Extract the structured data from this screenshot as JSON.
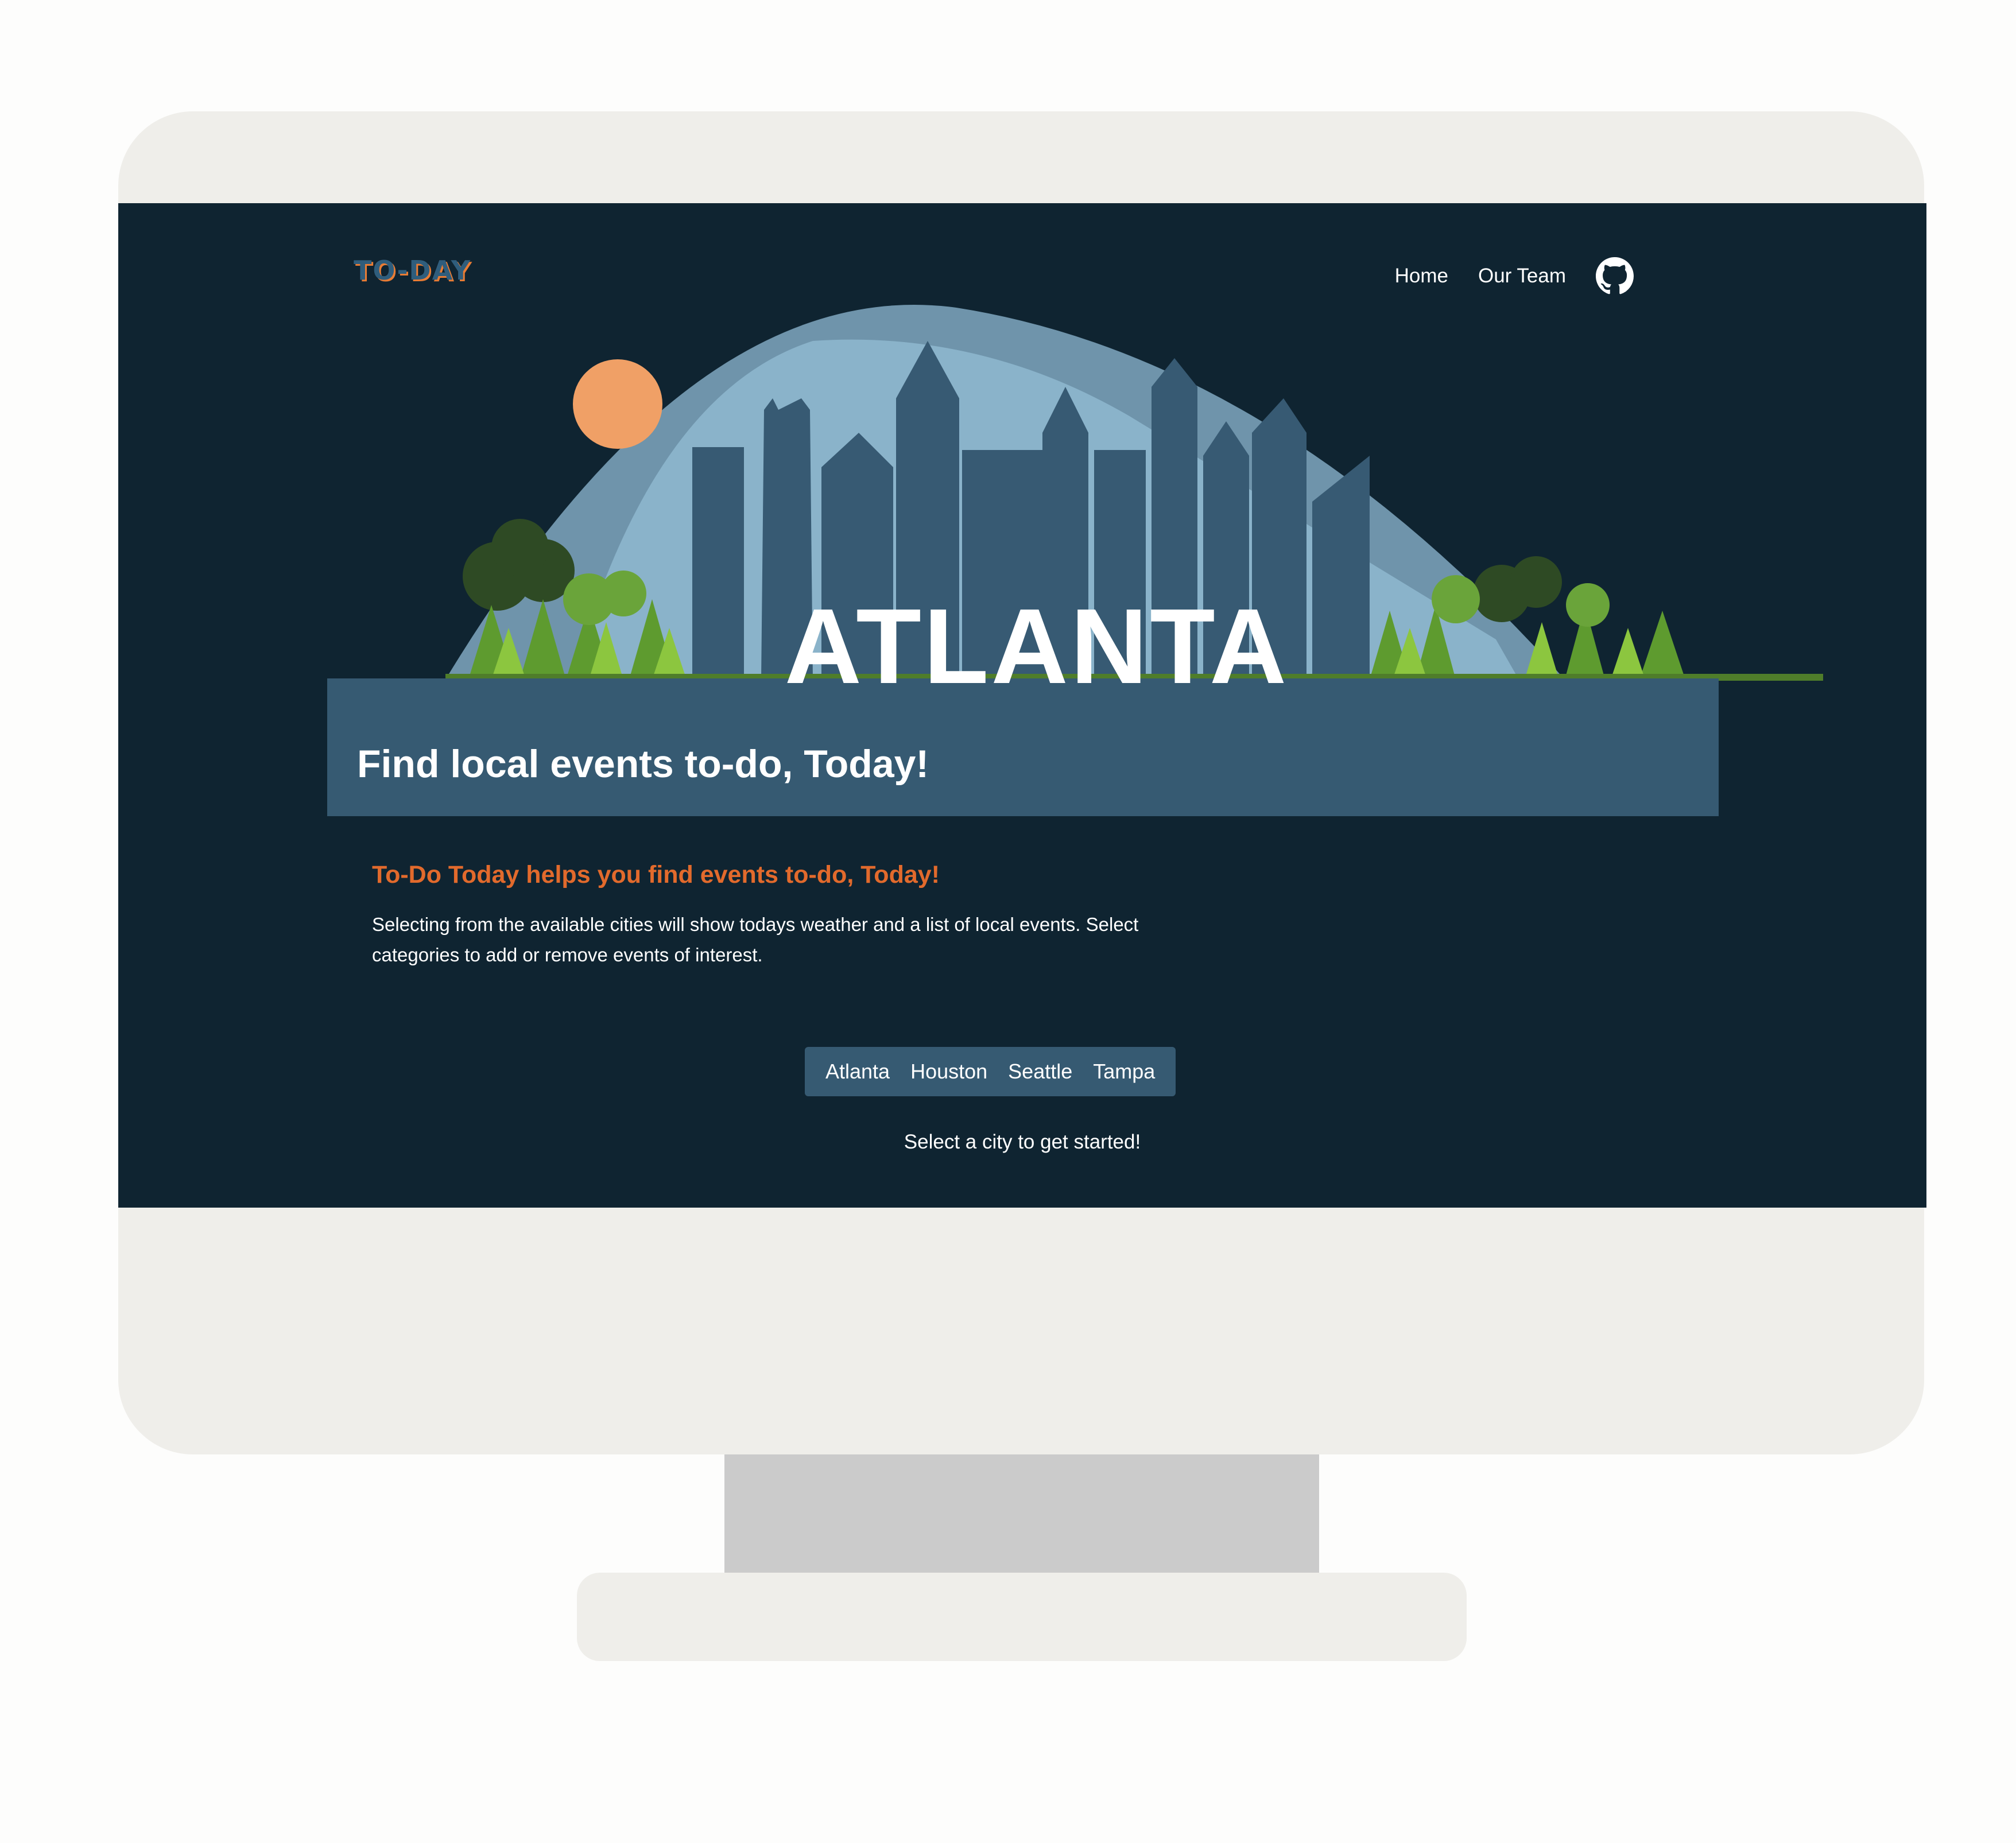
{
  "header": {
    "logo_text": "TO-DAY",
    "nav": [
      {
        "label": "Home"
      },
      {
        "label": "Our Team"
      }
    ],
    "github_icon": "github-icon"
  },
  "hero": {
    "city_name": "ATLANTA",
    "tagline": "Find local events to-do, Today!"
  },
  "intro": {
    "heading": "To-Do Today helps you find events to-do, Today!",
    "body": "Selecting from the available cities will show todays weather and a list of local events. Select categories to add or remove events of interest."
  },
  "city_selector": {
    "options": [
      "Atlanta",
      "Houston",
      "Seattle",
      "Tampa"
    ]
  },
  "status": {
    "prompt": "Select a city to get started!"
  },
  "colors": {
    "background": "#0f2431",
    "band": "#365a72",
    "accent": "#e26a2c",
    "sun": "#f0a066"
  }
}
